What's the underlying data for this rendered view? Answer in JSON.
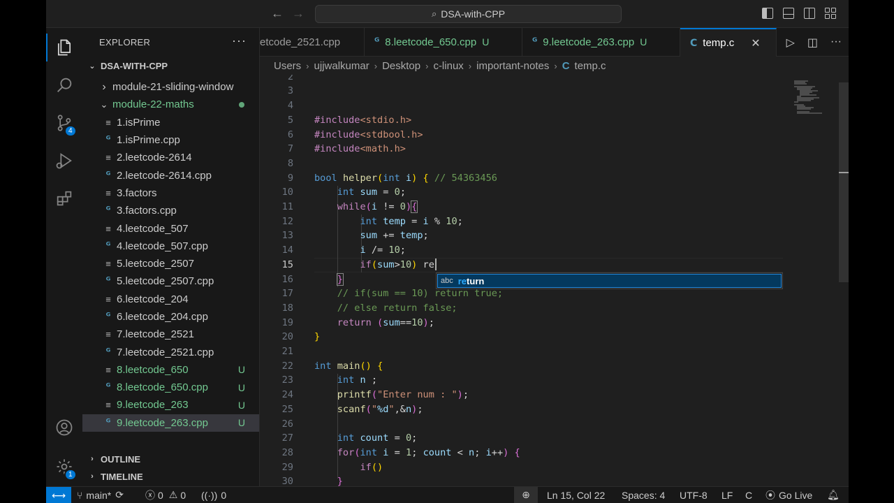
{
  "title_bar": {
    "search_text": "DSA-with-CPP"
  },
  "activity_bar": {
    "source_control_badge": "4",
    "settings_badge": "1"
  },
  "sidebar": {
    "title": "EXPLORER",
    "more": "···",
    "root_folder": "DSA-WITH-CPP",
    "items": [
      {
        "label": "module-21-sliding-window",
        "kind": "folder-collapsed",
        "indent": 1,
        "status": ""
      },
      {
        "label": "module-22-maths",
        "kind": "folder-open",
        "indent": 1,
        "status": "dot"
      },
      {
        "label": "1.isPrime",
        "kind": "text",
        "indent": 2,
        "status": ""
      },
      {
        "label": "1.isPrime.cpp",
        "kind": "cpp",
        "indent": 2,
        "status": ""
      },
      {
        "label": "2.leetcode-2614",
        "kind": "text",
        "indent": 2,
        "status": ""
      },
      {
        "label": "2.leetcode-2614.cpp",
        "kind": "cpp",
        "indent": 2,
        "status": ""
      },
      {
        "label": "3.factors",
        "kind": "text",
        "indent": 2,
        "status": ""
      },
      {
        "label": "3.factors.cpp",
        "kind": "cpp",
        "indent": 2,
        "status": ""
      },
      {
        "label": "4.leetcode_507",
        "kind": "text",
        "indent": 2,
        "status": ""
      },
      {
        "label": "4.leetcode_507.cpp",
        "kind": "cpp",
        "indent": 2,
        "status": ""
      },
      {
        "label": "5.leetcode_2507",
        "kind": "text",
        "indent": 2,
        "status": ""
      },
      {
        "label": "5.leetcode_2507.cpp",
        "kind": "cpp",
        "indent": 2,
        "status": ""
      },
      {
        "label": "6.leetcode_204",
        "kind": "text",
        "indent": 2,
        "status": ""
      },
      {
        "label": "6.leetcode_204.cpp",
        "kind": "cpp",
        "indent": 2,
        "status": ""
      },
      {
        "label": "7.leetcode_2521",
        "kind": "text",
        "indent": 2,
        "status": ""
      },
      {
        "label": "7.leetcode_2521.cpp",
        "kind": "cpp",
        "indent": 2,
        "status": ""
      },
      {
        "label": "8.leetcode_650",
        "kind": "text",
        "indent": 2,
        "status": "U"
      },
      {
        "label": "8.leetcode_650.cpp",
        "kind": "cpp",
        "indent": 2,
        "status": "U"
      },
      {
        "label": "9.leetcode_263",
        "kind": "text",
        "indent": 2,
        "status": "U"
      },
      {
        "label": "9.leetcode_263.cpp",
        "kind": "cpp",
        "indent": 2,
        "status": "U",
        "selected": true
      }
    ],
    "outline_label": "OUTLINE",
    "timeline_label": "TIMELINE"
  },
  "tabs": [
    {
      "label": "etcode_2521.cpp",
      "icon": "",
      "status": ""
    },
    {
      "label": "8.leetcode_650.cpp",
      "icon": "cpp",
      "status": "U"
    },
    {
      "label": "9.leetcode_263.cpp",
      "icon": "cpp",
      "status": "U"
    },
    {
      "label": "temp.c",
      "icon": "c",
      "status": "",
      "active": true
    }
  ],
  "breadcrumb": {
    "parts": [
      "Users",
      "ujjwalkumar",
      "Desktop",
      "c-linux",
      "important-notes"
    ],
    "file_icon": "C",
    "file": "temp.c"
  },
  "editor": {
    "current_line": 15,
    "first_line": 2,
    "suggestion": {
      "kind": "abc",
      "match": "re",
      "rest": "turn"
    }
  },
  "status_bar": {
    "branch": "main*",
    "errors": "0",
    "warnings": "0",
    "ports": "0",
    "position": "Ln 15, Col 22",
    "spaces": "Spaces: 4",
    "encoding": "UTF-8",
    "eol": "LF",
    "language": "C",
    "go_live": "Go Live"
  },
  "colors": {
    "accent": "#0078d4",
    "untracked": "#73c991",
    "editor_bg": "#1f1f1f",
    "sidebar_bg": "#181818"
  }
}
